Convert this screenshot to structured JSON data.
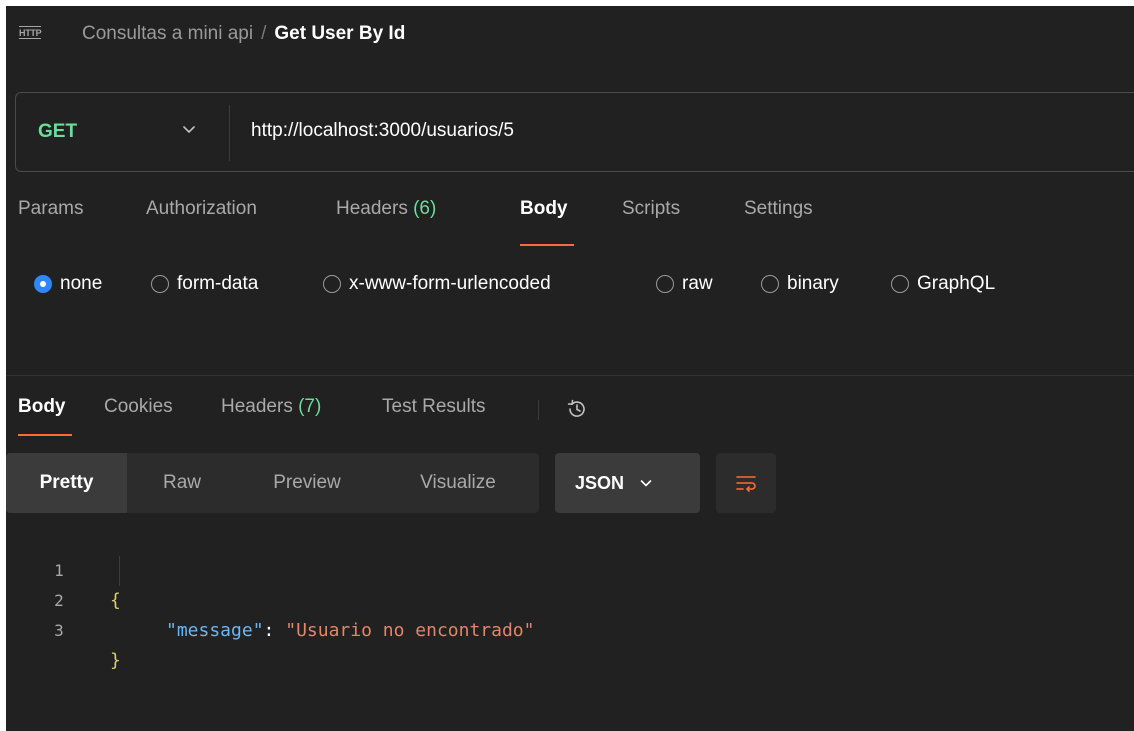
{
  "header": {
    "icon": "HTTP",
    "collection": "Consultas a mini api",
    "separator": "/",
    "request_name": "Get User By Id"
  },
  "request": {
    "method": "GET",
    "url": "http://localhost:3000/usuarios/5"
  },
  "request_tabs": [
    {
      "label": "Params",
      "count": null
    },
    {
      "label": "Authorization",
      "count": null
    },
    {
      "label": "Headers",
      "count": "(6)"
    },
    {
      "label": "Body",
      "count": null,
      "active": true
    },
    {
      "label": "Scripts",
      "count": null
    },
    {
      "label": "Settings",
      "count": null
    }
  ],
  "body_options": [
    {
      "label": "none",
      "checked": true
    },
    {
      "label": "form-data"
    },
    {
      "label": "x-www-form-urlencoded"
    },
    {
      "label": "raw"
    },
    {
      "label": "binary"
    },
    {
      "label": "GraphQL"
    }
  ],
  "response_tabs": [
    {
      "label": "Body",
      "active": true
    },
    {
      "label": "Cookies"
    },
    {
      "label": "Headers",
      "count": "(7)"
    },
    {
      "label": "Test Results"
    }
  ],
  "view_modes": [
    "Pretty",
    "Raw",
    "Preview",
    "Visualize"
  ],
  "format": "JSON",
  "response_code": {
    "line_numbers": [
      "1",
      "2",
      "3"
    ],
    "open_brace": "{",
    "key": "\"message\"",
    "colon": ": ",
    "value": "\"Usuario no encontrado\"",
    "close_brace": "}"
  },
  "colors": {
    "method": "#6bdd9a",
    "accent_underline": "#ff6c37",
    "radio_checked": "#2f87ff",
    "count": "#6bdd9a",
    "json_key": "#6fb6f0",
    "json_string": "#e0866a",
    "json_brace": "#d8d060"
  },
  "icons": {
    "method_dropdown": "chevron-down-icon",
    "history": "history-icon",
    "format_dropdown": "chevron-down-icon",
    "wrap": "wrap-lines-icon"
  }
}
